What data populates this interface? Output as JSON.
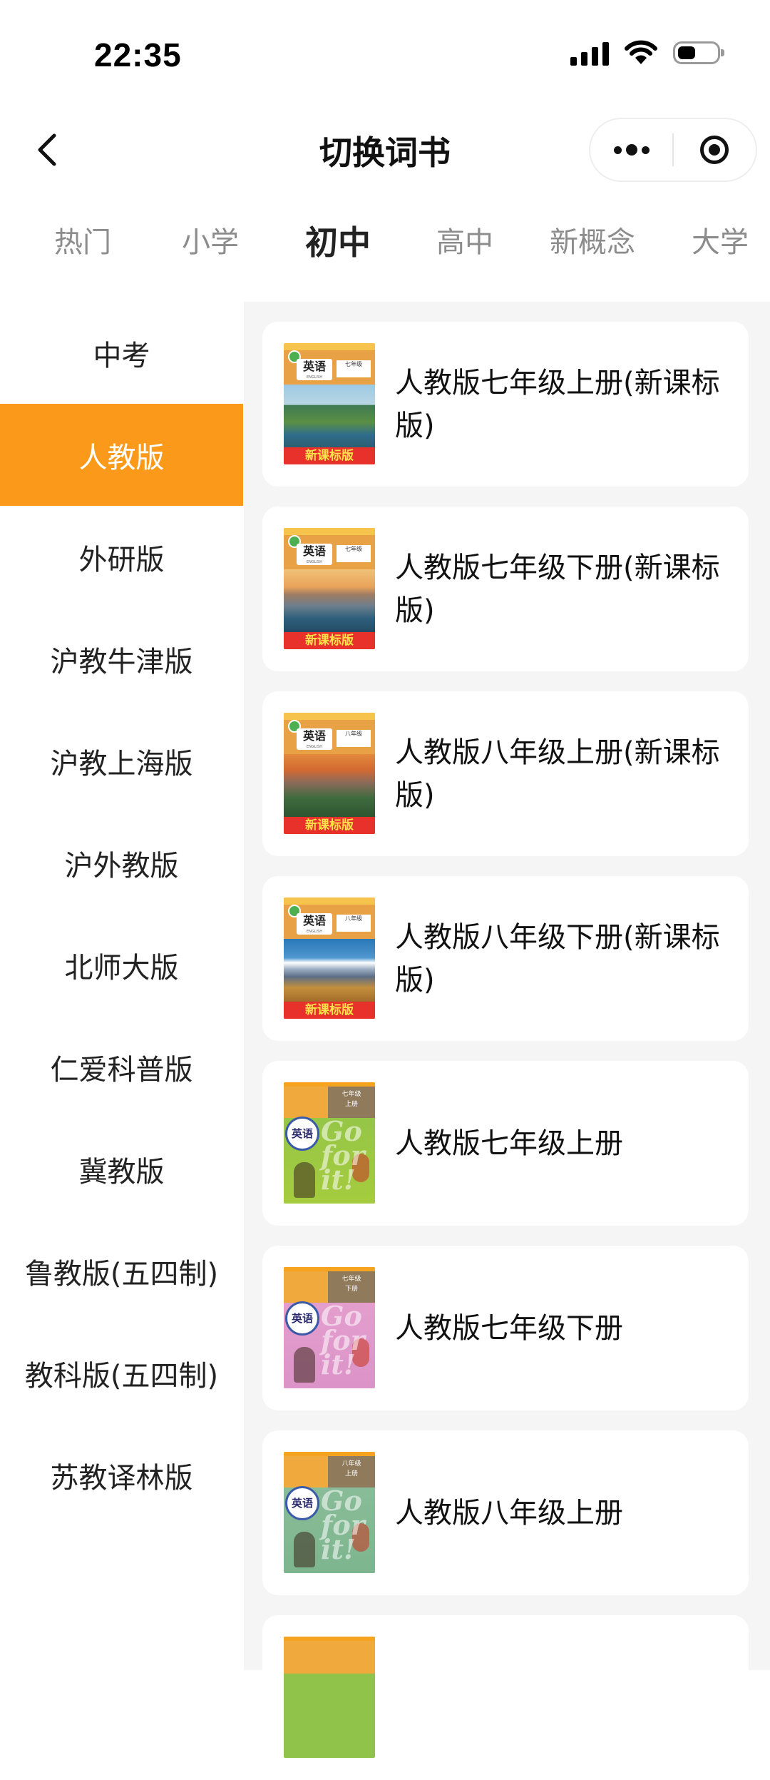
{
  "status_bar": {
    "time": "22:35"
  },
  "nav": {
    "title": "切换词书"
  },
  "tabs": [
    {
      "label": "热门"
    },
    {
      "label": "小学"
    },
    {
      "label": "初中",
      "active": true
    },
    {
      "label": "高中"
    },
    {
      "label": "新概念"
    },
    {
      "label": "大学"
    }
  ],
  "sidebar": {
    "items": [
      {
        "label": "中考"
      },
      {
        "label": "人教版",
        "active": true
      },
      {
        "label": "外研版"
      },
      {
        "label": "沪教牛津版"
      },
      {
        "label": "沪教上海版"
      },
      {
        "label": "沪外教版"
      },
      {
        "label": "北师大版"
      },
      {
        "label": "仁爱科普版"
      },
      {
        "label": "冀教版"
      },
      {
        "label": "鲁教版(五四制)"
      },
      {
        "label": "教科版(五四制)"
      },
      {
        "label": "苏教译林版"
      }
    ]
  },
  "books": [
    {
      "title": "人教版七年级上册(新课标版)",
      "cover": {
        "style": "new",
        "subject": "英语",
        "badge": "新课标版",
        "grade": "七年级"
      }
    },
    {
      "title": "人教版七年级下册(新课标版)",
      "cover": {
        "style": "new",
        "subject": "英语",
        "badge": "新课标版",
        "grade": "七年级"
      }
    },
    {
      "title": "人教版八年级上册(新课标版)",
      "cover": {
        "style": "new",
        "subject": "英语",
        "badge": "新课标版",
        "grade": "八年级"
      }
    },
    {
      "title": "人教版八年级下册(新课标版)",
      "cover": {
        "style": "new",
        "subject": "英语",
        "badge": "新课标版",
        "grade": "八年级"
      }
    },
    {
      "title": "人教版七年级上册",
      "cover": {
        "style": "goforit",
        "subject": "英语",
        "grade": "七年级",
        "term": "上册"
      }
    },
    {
      "title": "人教版七年级下册",
      "cover": {
        "style": "goforit",
        "subject": "英语",
        "grade": "七年级",
        "term": "下册"
      }
    },
    {
      "title": "人教版八年级上册",
      "cover": {
        "style": "goforit",
        "subject": "英语",
        "grade": "八年级",
        "term": "上册"
      }
    }
  ],
  "colors": {
    "accent": "#fb9a1a",
    "content_bg": "#f5f5f5"
  }
}
